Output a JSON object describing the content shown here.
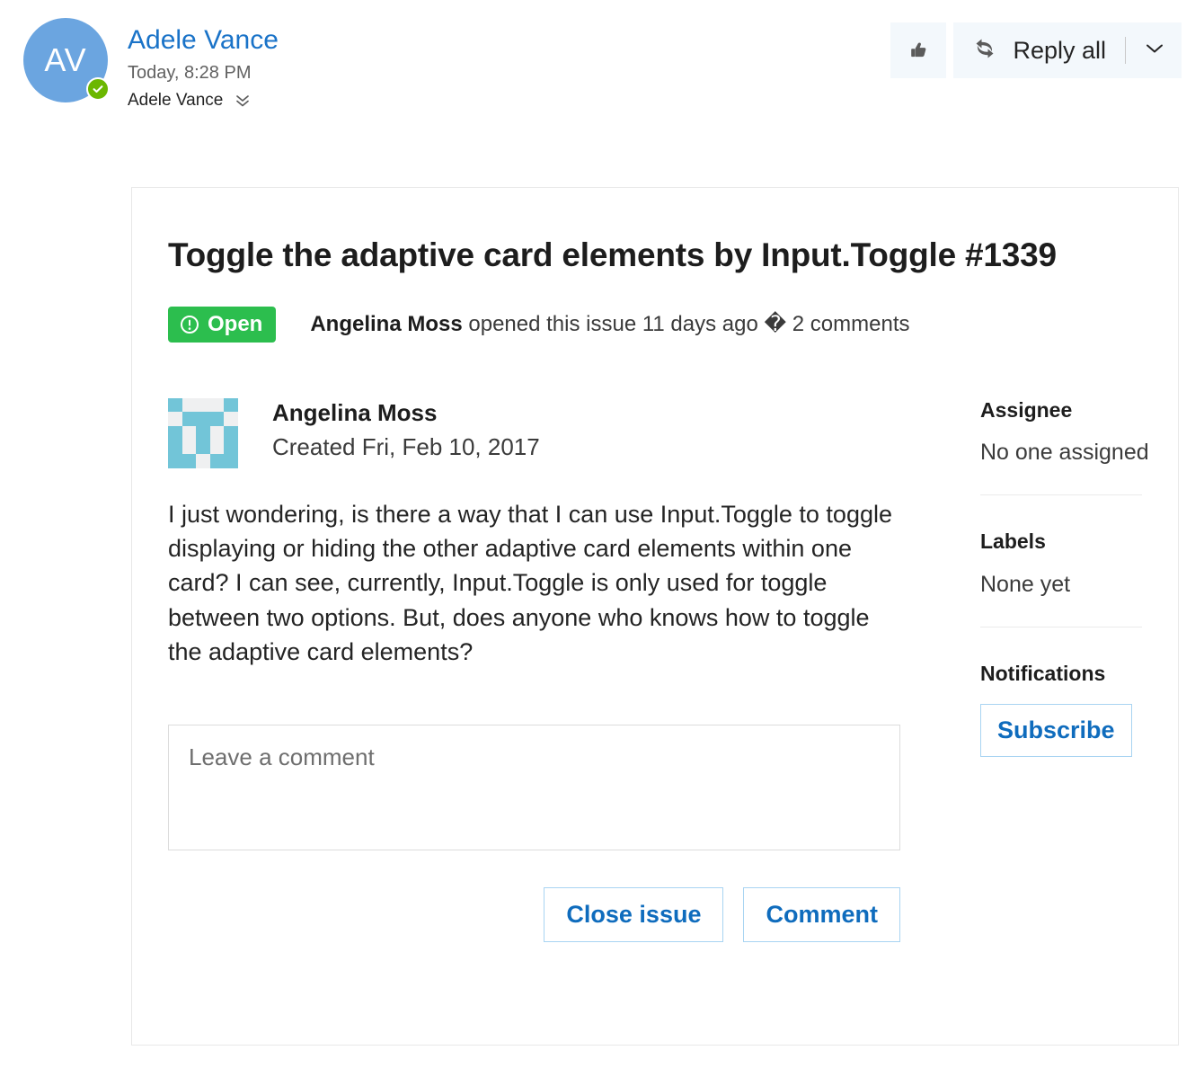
{
  "message_header": {
    "avatar_initials": "AV",
    "presence_icon": "check-circle-icon",
    "sender_name": "Adele Vance",
    "timestamp": "Today, 8:28 PM",
    "recipients": "Adele Vance",
    "expand_icon": "chevron-double-down-icon"
  },
  "actions": {
    "like_icon": "thumbs-up-icon",
    "reply_all_icon": "reply-all-icon",
    "reply_all_label": "Reply all",
    "dropdown_icon": "chevron-down-icon"
  },
  "issue": {
    "title": "Toggle the adaptive card elements by Input.Toggle #1339",
    "state_label": "Open",
    "state_icon": "exclamation-circle-icon",
    "state_color": "#2cbe4e",
    "meta_author": "Angelina Moss",
    "meta_action": " opened this issue 11 days ago ",
    "meta_separator": "�",
    "meta_comments": " 2 comments"
  },
  "comment": {
    "avatar_icon": "identicon-avatar",
    "author": "Angelina Moss",
    "created": "Created Fri, Feb 10, 2017",
    "body": "I just wondering, is there a way that I can use Input.Toggle to toggle displaying or hiding the other adaptive card elements within one card? I can see, currently, Input.Toggle is only used for toggle between two options. But, does anyone who knows how to toggle the adaptive card elements?"
  },
  "compose": {
    "placeholder": "Leave a comment",
    "value": "",
    "close_issue_label": "Close issue",
    "comment_label": "Comment"
  },
  "sidebar": {
    "assignee_title": "Assignee",
    "assignee_value": "No one assigned",
    "labels_title": "Labels",
    "labels_value": "None yet",
    "notifications_title": "Notifications",
    "subscribe_label": "Subscribe"
  },
  "identicon_grid": [
    [
      1,
      0,
      0,
      0,
      1
    ],
    [
      0,
      1,
      1,
      1,
      0
    ],
    [
      1,
      0,
      1,
      0,
      1
    ],
    [
      1,
      0,
      1,
      0,
      1
    ],
    [
      1,
      1,
      0,
      1,
      1
    ]
  ]
}
